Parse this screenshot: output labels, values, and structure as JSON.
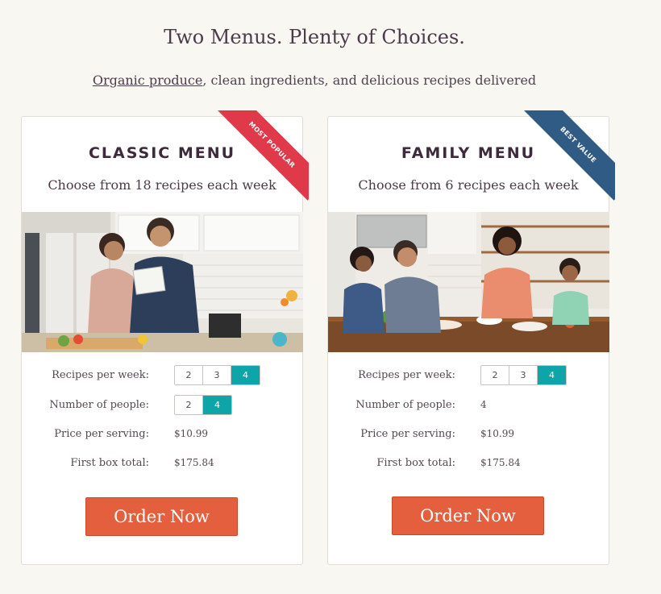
{
  "header": {
    "title": "Two Menus. Plenty of Choices.",
    "subtitle_link": "Organic produce",
    "subtitle_rest": ", clean ingredients, and delicious recipes delivered"
  },
  "colors": {
    "accent_teal": "#0ea5a9",
    "order_button": "#e35f3e",
    "ribbon_popular": "#e0394a",
    "ribbon_value": "#2f5b84"
  },
  "classic": {
    "title": "CLASSIC MENU",
    "subtitle": "Choose from 18 recipes each week",
    "ribbon": "MOST POPULAR",
    "recipes_label": "Recipes per week:",
    "recipes_options": [
      "2",
      "3",
      "4"
    ],
    "recipes_selected": "4",
    "people_label": "Number of people:",
    "people_options": [
      "2",
      "4"
    ],
    "people_selected": "4",
    "price_label": "Price per serving:",
    "price_value": "$10.99",
    "total_label": "First box total:",
    "total_value": "$175.84",
    "order_label": "Order Now"
  },
  "family": {
    "title": "FAMILY MENU",
    "subtitle": "Choose from 6 recipes each week",
    "ribbon": "BEST VALUE",
    "recipes_label": "Recipes per week:",
    "recipes_options": [
      "2",
      "3",
      "4"
    ],
    "recipes_selected": "4",
    "people_label": "Number of people:",
    "people_value": "4",
    "price_label": "Price per serving:",
    "price_value": "$10.99",
    "total_label": "First box total:",
    "total_value": "$175.84",
    "order_label": "Order Now"
  }
}
